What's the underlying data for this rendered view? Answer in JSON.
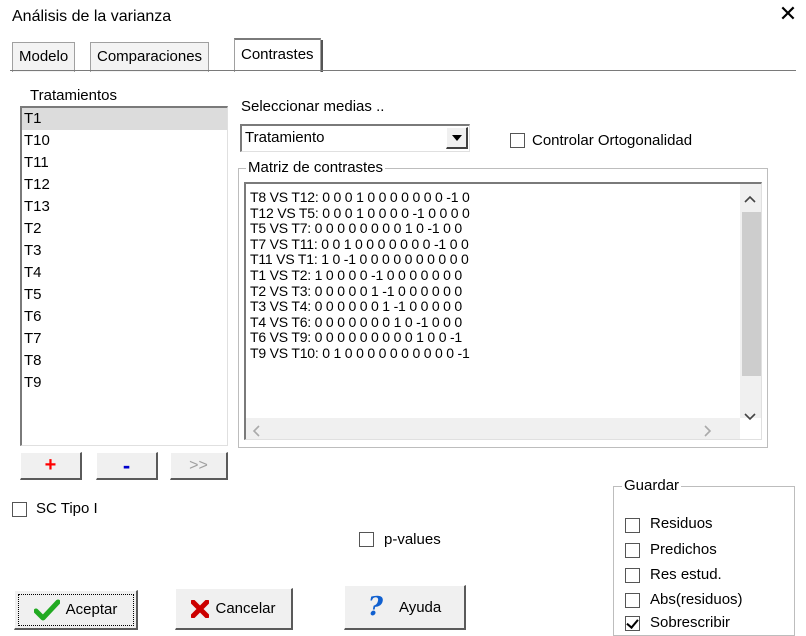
{
  "window": {
    "title": "Análisis de la varianza",
    "close_glyph": "✕"
  },
  "tabs": [
    {
      "label": "Modelo"
    },
    {
      "label": "Comparaciones"
    },
    {
      "label": "Contrastes",
      "active": true
    }
  ],
  "tratamientos": {
    "label": "Tratamientos",
    "items": [
      "T1",
      "T10",
      "T11",
      "T12",
      "T13",
      "T2",
      "T3",
      "T4",
      "T5",
      "T6",
      "T7",
      "T8",
      "T9"
    ],
    "selected": "T1",
    "buttons": {
      "add": "+",
      "remove": "-",
      "move": ">>"
    }
  },
  "seleccionar": {
    "label": "Seleccionar medias ..",
    "value": "Tratamiento"
  },
  "ortogonalidad": {
    "label": "Controlar Ortogonalidad",
    "checked": false
  },
  "matriz": {
    "label": "Matriz de contrastes",
    "lines": [
      "T8 VS T12: 0 0 0 1 0 0 0 0 0 0 0 -1 0",
      "T12 VS T5: 0 0 0 1 0 0 0 0 -1 0 0 0 0",
      "T5 VS T7: 0 0 0 0 0 0 0 0 1 0 -1 0 0",
      "T7 VS T11: 0 0 1 0 0 0 0 0 0 0 -1 0 0",
      "T11 VS T1: 1 0 -1 0 0 0 0 0 0 0 0 0 0",
      "T1 VS T2: 1 0 0 0 0 -1 0 0 0 0 0 0 0",
      "T2 VS T3: 0 0 0 0 0 1 -1 0 0 0 0 0 0",
      "T3 VS T4: 0 0 0 0 0 0 1 -1 0 0 0 0 0",
      "T4 VS T6: 0 0 0 0 0 0 0 1 0 -1 0 0 0",
      "T6 VS T9: 0 0 0 0 0 0 0 0 0 1 0 0 -1",
      "T9 VS T10: 0 1 0 0 0 0 0 0 0 0 0 0 -1"
    ]
  },
  "sc_tipo": {
    "label": "SC Tipo I",
    "checked": false
  },
  "pvalues": {
    "label": "p-values",
    "checked": false
  },
  "guardar": {
    "label": "Guardar",
    "items": [
      {
        "label": "Residuos",
        "checked": false
      },
      {
        "label": "Predichos",
        "checked": false
      },
      {
        "label": "Res estud.",
        "checked": false
      },
      {
        "label": "Abs(residuos)",
        "checked": false
      },
      {
        "label": "Sobrescribir",
        "checked": true
      }
    ]
  },
  "buttons": {
    "aceptar": "Aceptar",
    "cancelar": "Cancelar",
    "ayuda": "Ayuda"
  },
  "colors": {
    "add_red": "#ff0000",
    "remove_blue": "#0000cc",
    "disabled": "#a0a0a0",
    "check_green": "#22aa22",
    "cross_red": "#cc0000",
    "help_blue": "#1060d0"
  }
}
